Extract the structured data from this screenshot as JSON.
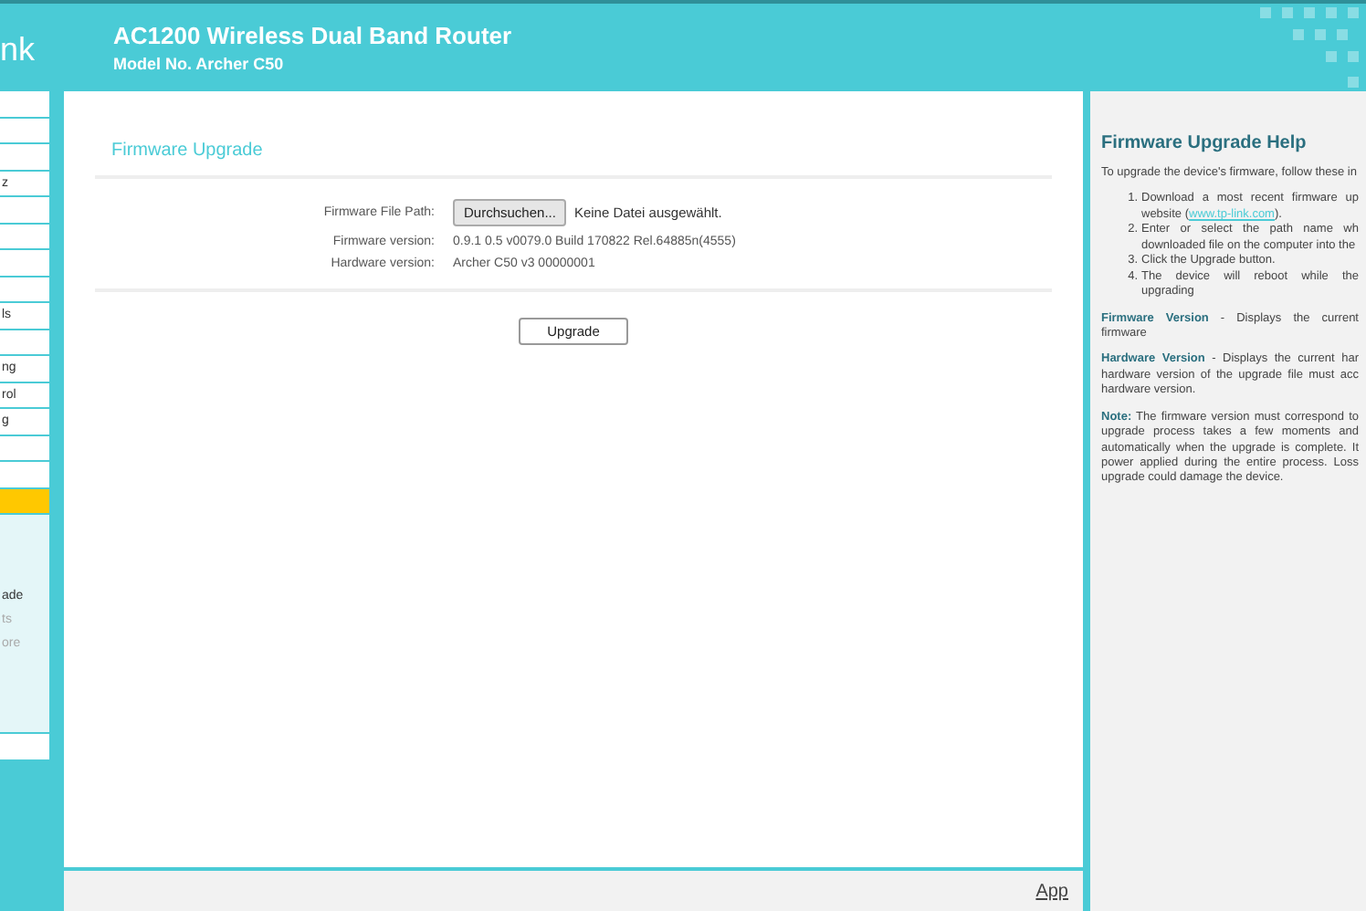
{
  "header": {
    "logo": "nk",
    "title": "AC1200 Wireless Dual Band Router",
    "model": "Model No. Archer C50"
  },
  "sidebar": {
    "items": [
      {
        "selected": false
      },
      {
        "selected": false
      },
      {
        "selected": false
      },
      {
        "label": "z",
        "selected": false
      },
      {
        "selected": false
      },
      {
        "selected": false
      },
      {
        "selected": false
      },
      {
        "selected": false
      },
      {
        "label": "ls",
        "selected": false
      },
      {
        "selected": false
      },
      {
        "label": "ng",
        "selected": false
      },
      {
        "label": "rol",
        "selected": false
      },
      {
        "label": "g",
        "selected": false
      },
      {
        "selected": false
      },
      {
        "selected": false
      },
      {
        "selected": true,
        "expanded": true,
        "children": [
          {
            "label": "ade",
            "selected": true
          },
          {
            "label": "ts",
            "selected": false
          },
          {
            "label": "ore",
            "selected": false
          }
        ]
      },
      {
        "selected": false
      }
    ]
  },
  "main": {
    "title": "Firmware Upgrade",
    "fields": [
      {
        "kind": "file",
        "label": "Firmware File Path:",
        "button": "Durchsuchen...",
        "value": "Keine Datei ausgewählt."
      },
      {
        "kind": "text",
        "label": "Firmware version:",
        "value": "0.9.1 0.5 v0079.0 Build 170822 Rel.64885n(4555)"
      },
      {
        "kind": "text",
        "label": "Hardware version:",
        "value": "Archer C50 v3 00000001"
      }
    ],
    "button": "Upgrade"
  },
  "footer": {
    "link": "App"
  },
  "help": {
    "title": "Firmware Upgrade Help",
    "intro": "To upgrade the device's firmware, follow these in",
    "steps": [
      {
        "marker": "1.",
        "text": "Download a most recent firmware up website (",
        "link": "www.tp-link.com",
        "after": ")."
      },
      {
        "marker": "2.",
        "text": "Enter or select the path name wh downloaded file on the computer into the"
      },
      {
        "marker": "3.",
        "text": "Click the Upgrade button."
      },
      {
        "marker": "4.",
        "text": "The device will reboot while the upgrading"
      }
    ],
    "paragraphs": [
      "**Firmware Version** - Displays the current firmware",
      "**Hardware Version** - Displays the current har hardware version of the upgrade file must acc hardware version.",
      "**Note:** The firmware version must correspond to upgrade process takes a few moments and automatically when the upgrade is complete. It power applied during the entire process. Loss upgrade could damage the device."
    ]
  }
}
